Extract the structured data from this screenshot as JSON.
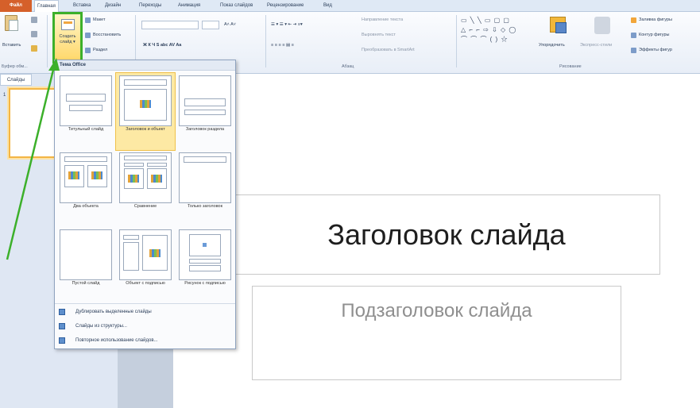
{
  "tabs": {
    "file": "Файл",
    "home": "Главная",
    "insert": "Вставка",
    "design": "Дизайн",
    "transitions": "Переходы",
    "animations": "Анимация",
    "slideshow": "Показ слайдов",
    "review": "Рецензирование",
    "view": "Вид"
  },
  "ribbon": {
    "paste": "Вставить",
    "clipboard_group": "Буфер обм...",
    "new_slide_line1": "Создать",
    "new_slide_line2": "слайд",
    "layout": "Макет",
    "reset": "Восстановить",
    "section": "Раздел",
    "text_direction": "Направление текста",
    "align_text": "Выровнять текст",
    "convert_smartart": "Преобразовать в SmartArt",
    "paragraph_group": "Абзац",
    "arrange": "Упорядочить",
    "quick_styles": "Экспресс-стили",
    "shape_fill": "Заливка фигуры",
    "shape_outline": "Контур фигуры",
    "shape_effects": "Эффекты фигур",
    "drawing_group": "Рисование",
    "shapes_glyphs": [
      "▭ ╲ ╲ ▭ ▢ ▢",
      "△ ⌐ ⌐ ⇨ ⇩ ◇ ◯",
      "⌒ ⌒ ⌒ ( ) ☆"
    ],
    "font_format_glyphs": "Ж  К  Ч  S  abc  AV  Aa",
    "para_format_glyphs": "≡  ≡  ≡  ≡  ▤  ≡"
  },
  "left_pane": {
    "tab_slides": "Слайды",
    "slide_number": "1"
  },
  "slide": {
    "title": "Заголовок слайда",
    "subtitle": "Подзаголовок слайда"
  },
  "dropdown": {
    "header": "Тема Office",
    "layouts": [
      {
        "label": "Титульный слайд"
      },
      {
        "label": "Заголовок и объект"
      },
      {
        "label": "Заголовок раздела"
      },
      {
        "label": "Два объекта"
      },
      {
        "label": "Сравнение"
      },
      {
        "label": "Только заголовок"
      },
      {
        "label": "Пустой слайд"
      },
      {
        "label": "Объект с подписью"
      },
      {
        "label": "Рисунок с подписью"
      }
    ],
    "menu": [
      {
        "label": "Дублировать выделенные слайды"
      },
      {
        "label": "Слайды из структуры..."
      },
      {
        "label": "Повторное использование слайдов..."
      }
    ]
  },
  "colors": {
    "file_tab": "#d5602a",
    "highlight_green": "#3cb02a",
    "selected_layout": "#fde9a4"
  }
}
